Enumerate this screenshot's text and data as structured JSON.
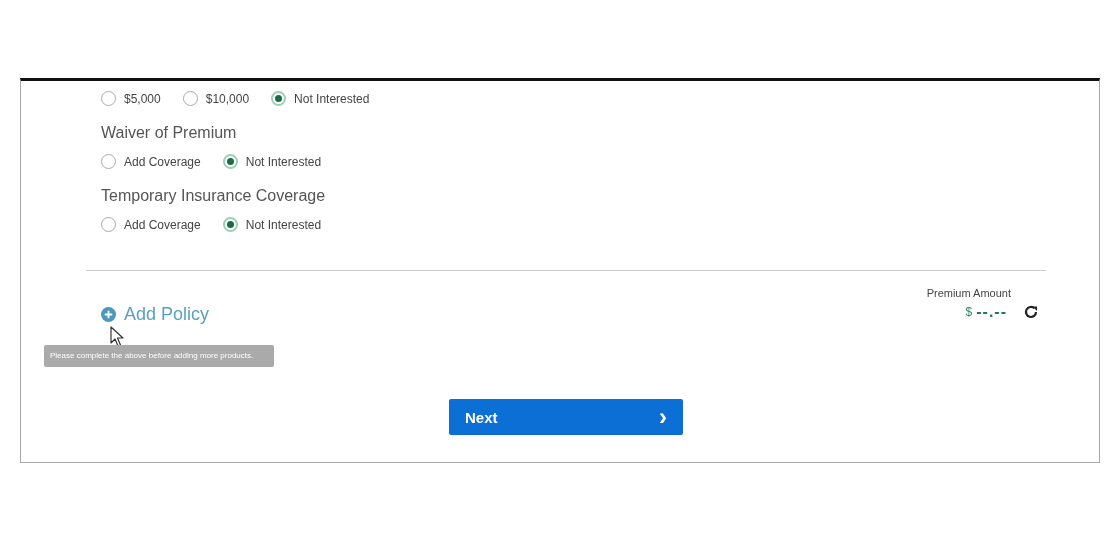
{
  "coverage_groups": [
    {
      "options": [
        {
          "label": "$5,000",
          "selected": false
        },
        {
          "label": "$10,000",
          "selected": false
        },
        {
          "label": "Not Interested",
          "selected": true
        }
      ]
    },
    {
      "title": "Waiver of Premium",
      "options": [
        {
          "label": "Add Coverage",
          "selected": false
        },
        {
          "label": "Not Interested",
          "selected": true
        }
      ]
    },
    {
      "title": "Temporary Insurance Coverage",
      "options": [
        {
          "label": "Add Coverage",
          "selected": false
        },
        {
          "label": "Not Interested",
          "selected": true
        }
      ]
    }
  ],
  "add_policy": {
    "label": "Add Policy",
    "tooltip": "Please complete the above before adding more products."
  },
  "premium": {
    "label": "Premium Amount",
    "currency": "$",
    "amount": "--.--"
  },
  "next_button": {
    "label": "Next",
    "icon": "›"
  }
}
